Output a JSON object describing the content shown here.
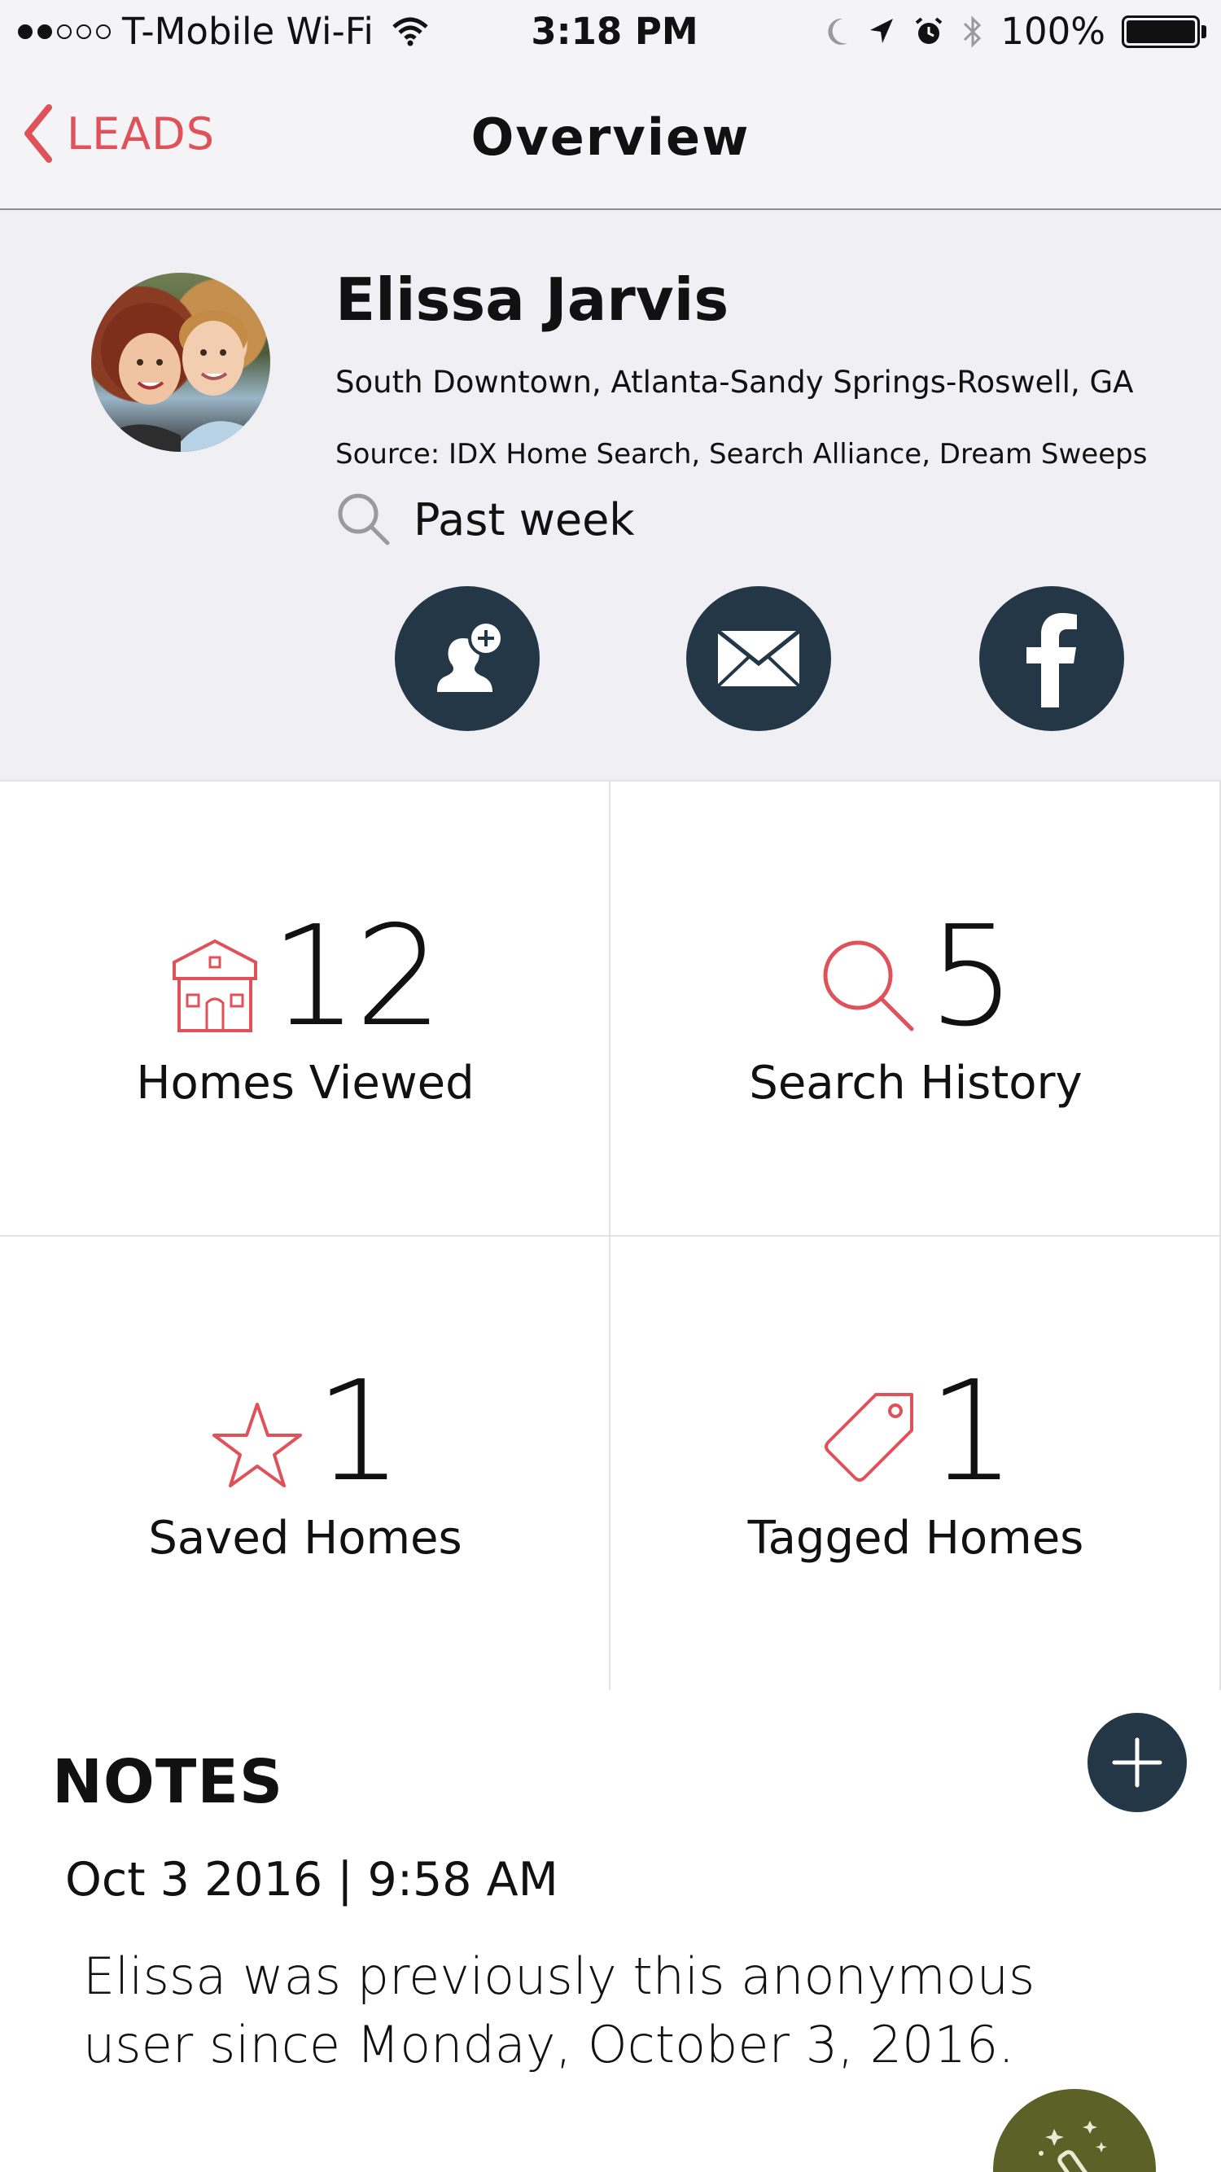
{
  "status_bar": {
    "carrier": "T-Mobile Wi-Fi",
    "time": "3:18 PM",
    "battery": "100%"
  },
  "nav": {
    "back_label": "LEADS",
    "title": "Overview"
  },
  "profile": {
    "name": "Elissa Jarvis",
    "location": "South Downtown, Atlanta-Sandy Springs-Roswell, GA",
    "source": "Source: IDX Home Search, Search Alliance, Dream Sweeps",
    "last_activity": "Past week"
  },
  "actions": {
    "add_contact": "add-contact-icon",
    "email": "envelope-icon",
    "facebook": "facebook-icon"
  },
  "stats": [
    {
      "count": "12",
      "label": "Homes Viewed",
      "icon": "house-icon"
    },
    {
      "count": "5",
      "label": "Search History",
      "icon": "search-icon"
    },
    {
      "count": "1",
      "label": "Saved Homes",
      "icon": "star-icon"
    },
    {
      "count": "1",
      "label": "Tagged Homes",
      "icon": "tag-icon"
    }
  ],
  "notes": {
    "title": "NOTES",
    "items": [
      {
        "timestamp": "Oct 3 2016 | 9:58 AM",
        "text": "Elissa was previously this anonymous user since Monday, October 3, 2016."
      }
    ]
  },
  "colors": {
    "accent": "#e0525a",
    "dark_button": "#243746",
    "fab": "#5b6127",
    "header_bg": "#f4f4f6",
    "profile_bg": "#efeff4"
  }
}
